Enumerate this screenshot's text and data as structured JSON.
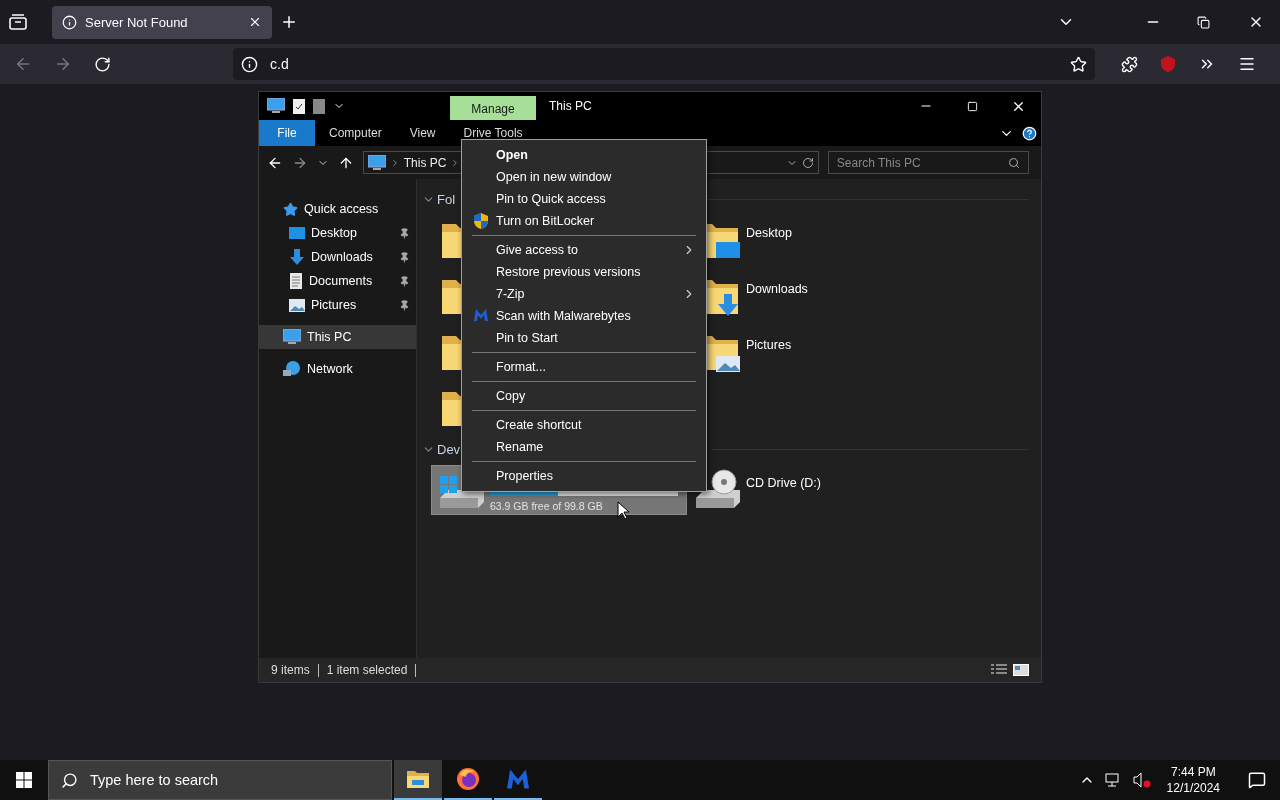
{
  "browser": {
    "tabs": [
      {
        "title": "Server Not Found",
        "selected": true
      }
    ],
    "address": "c.d"
  },
  "explorer": {
    "context_tab": "Manage",
    "title": "This PC",
    "ribbon_tabs": [
      {
        "label": "File",
        "kind": "file"
      },
      {
        "label": "Computer",
        "kind": "tab"
      },
      {
        "label": "View",
        "kind": "tab"
      },
      {
        "label": "Drive Tools",
        "kind": "tab"
      }
    ],
    "breadcrumb": [
      "This PC"
    ],
    "search": {
      "placeholder": "Search This PC"
    },
    "nav": [
      {
        "label": "Quick access",
        "kind": "star",
        "selected": false,
        "children": [
          {
            "label": "Desktop",
            "kind": "desktop",
            "pinned": true,
            "selected": false
          },
          {
            "label": "Downloads",
            "kind": "downloads",
            "pinned": true,
            "selected": false
          },
          {
            "label": "Documents",
            "kind": "documents",
            "pinned": true,
            "selected": false
          },
          {
            "label": "Pictures",
            "kind": "pictures",
            "pinned": true,
            "selected": false
          }
        ]
      },
      {
        "label": "This PC",
        "kind": "pc",
        "selected": true
      },
      {
        "label": "Network",
        "kind": "network",
        "selected": false
      }
    ],
    "groups": [
      {
        "header": "Fol",
        "items": [
          {
            "kind": "folder"
          },
          {
            "kind": "desktop",
            "label": "Desktop"
          },
          {
            "kind": "folder"
          },
          {
            "kind": "downloads",
            "label": "Downloads"
          },
          {
            "kind": "folder"
          },
          {
            "kind": "pictures",
            "label": "Pictures"
          },
          {
            "kind": "folder"
          }
        ]
      },
      {
        "header": "Dev",
        "items": [
          {
            "kind": "disk",
            "selected": true,
            "level": 0.36,
            "detail": "63.9 GB free of 99.8 GB"
          },
          {
            "kind": "cd",
            "selected": false,
            "label": "CD Drive (D:)"
          }
        ]
      }
    ],
    "status": {
      "count": "9 items",
      "selection": "1 item selected"
    },
    "views": [
      {
        "kind": "details",
        "selected": false
      },
      {
        "kind": "tiles",
        "selected": true
      }
    ]
  },
  "context_menu": {
    "groups": [
      [
        {
          "label": "Open",
          "default": true,
          "kind": "plain",
          "submenu": false
        },
        {
          "label": "Open in new window",
          "default": false,
          "kind": "plain",
          "submenu": false
        },
        {
          "label": "Pin to Quick access",
          "default": false,
          "kind": "plain",
          "submenu": false
        },
        {
          "label": "Turn on BitLocker",
          "default": false,
          "kind": "shield",
          "submenu": false
        }
      ],
      [
        {
          "label": "Give access to",
          "default": false,
          "kind": "plain",
          "submenu": true
        },
        {
          "label": "Restore previous versions",
          "default": false,
          "kind": "plain",
          "submenu": false
        },
        {
          "label": "7-Zip",
          "default": false,
          "kind": "plain",
          "submenu": true
        },
        {
          "label": "Scan with Malwarebytes",
          "default": false,
          "kind": "malwarebytes",
          "submenu": false
        },
        {
          "label": "Pin to Start",
          "default": false,
          "kind": "plain",
          "submenu": false
        }
      ],
      [
        {
          "label": "Format...",
          "default": false,
          "kind": "plain",
          "submenu": false
        }
      ],
      [
        {
          "label": "Copy",
          "default": false,
          "kind": "plain",
          "submenu": false
        }
      ],
      [
        {
          "label": "Create shortcut",
          "default": false,
          "kind": "plain",
          "submenu": false
        },
        {
          "label": "Rename",
          "default": false,
          "kind": "plain",
          "submenu": false
        }
      ],
      [
        {
          "label": "Properties",
          "default": false,
          "kind": "plain",
          "submenu": false
        }
      ]
    ]
  },
  "taskbar": {
    "search": {
      "placeholder": "Type here to search"
    },
    "apps": [
      {
        "kind": "explorer",
        "selected": true
      },
      {
        "kind": "firefox",
        "selected": false
      },
      {
        "kind": "malwarebytes",
        "selected": false
      }
    ],
    "time": "7:44 PM",
    "date": "12/1/2024"
  }
}
